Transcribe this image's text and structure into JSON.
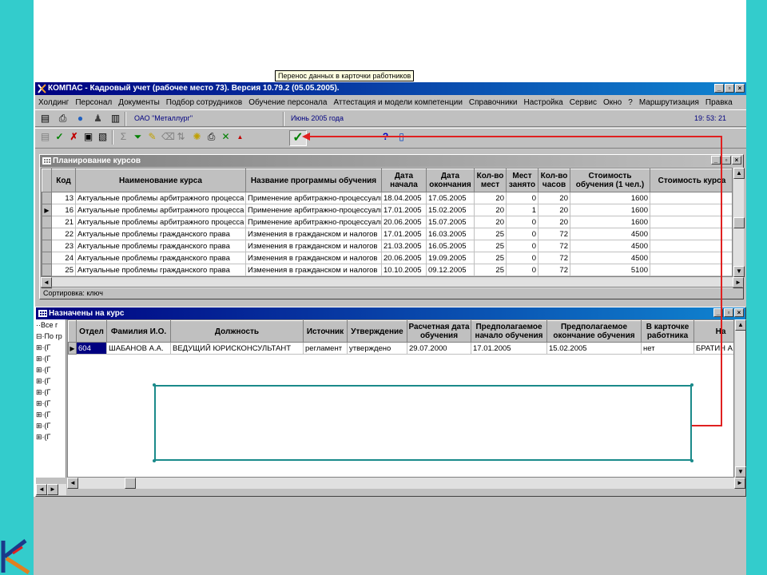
{
  "window": {
    "title": "КОМПАС - Кадровый учет (рабочее место 73). Версия 10.79.2 (05.05.2005).",
    "controls": [
      "_",
      "▫",
      "×"
    ]
  },
  "menu": [
    "Холдинг",
    "Персонал",
    "Документы",
    "Подбор сотрудников",
    "Обучение персонала",
    "Аттестация и модели компетенции",
    "Справочники",
    "Настройка",
    "Сервис",
    "Окно",
    "?",
    "Маршрутизация",
    "Правка"
  ],
  "toolbar": {
    "company": "ОАО \"Металлург\"",
    "period": "Июнь 2005 года",
    "clock": "19: 53: 21",
    "tooltip": "Перенос данных в карточки работников"
  },
  "courses": {
    "title": "Планирование курсов",
    "columns": [
      "Код",
      "Наименование курса",
      "Название программы обучения",
      "Дата начала",
      "Дата окончания",
      "Кол-во мест",
      "Мест занято",
      "Кол-во часов",
      "Стоимость обучения (1 чел.)",
      "Стоимость курса"
    ],
    "rows": [
      {
        "code": "13",
        "name": "Актуальные проблемы арбитражного процесса",
        "program": "Применение арбитражно-процессуальн",
        "start": "18.04.2005",
        "end": "17.05.2005",
        "seats": "20",
        "taken": "0",
        "hours": "20",
        "cost": "1600",
        "total": ""
      },
      {
        "code": "16",
        "name": "Актуальные проблемы арбитражного процесса",
        "program": "Применение арбитражно-процессуальн",
        "start": "17.01.2005",
        "end": "15.02.2005",
        "seats": "20",
        "taken": "1",
        "hours": "20",
        "cost": "1600",
        "total": ""
      },
      {
        "code": "21",
        "name": "Актуальные проблемы арбитражного процесса",
        "program": "Применение арбитражно-процессуальн",
        "start": "20.06.2005",
        "end": "15.07.2005",
        "seats": "20",
        "taken": "0",
        "hours": "20",
        "cost": "1600",
        "total": ""
      },
      {
        "code": "22",
        "name": "Актуальные проблемы гражданского права",
        "program": "Изменения в гражданском и налогов",
        "start": "17.01.2005",
        "end": "16.03.2005",
        "seats": "25",
        "taken": "0",
        "hours": "72",
        "cost": "4500",
        "total": ""
      },
      {
        "code": "23",
        "name": "Актуальные проблемы гражданского права",
        "program": "Изменения в гражданском и налогов",
        "start": "21.03.2005",
        "end": "16.05.2005",
        "seats": "25",
        "taken": "0",
        "hours": "72",
        "cost": "4500",
        "total": ""
      },
      {
        "code": "24",
        "name": "Актуальные проблемы гражданского права",
        "program": "Изменения в гражданском и налогов",
        "start": "20.06.2005",
        "end": "19.09.2005",
        "seats": "25",
        "taken": "0",
        "hours": "72",
        "cost": "4500",
        "total": ""
      },
      {
        "code": "25",
        "name": "Актуальные проблемы гражданского права",
        "program": "Изменения в гражданском и налогов",
        "start": "10.10.2005",
        "end": "09.12.2005",
        "seats": "25",
        "taken": "0",
        "hours": "72",
        "cost": "5100",
        "total": ""
      }
    ],
    "status": "Сортировка: ключ"
  },
  "assigned": {
    "title": "Назначены на курс",
    "tree": [
      "Все г",
      "По гр",
      "(Г",
      "(Г",
      "(Г",
      "(Г",
      "(Г",
      "(Г",
      "(Г",
      "(Г",
      "(Г"
    ],
    "columns": [
      "Отдел",
      "Фамилия И.О.",
      "Должность",
      "Источник",
      "Утверждение",
      "Расчетная дата обучения",
      "Предполагаемое начало обучения",
      "Предполагаемое окончание обучения",
      "В карточке работника",
      "На"
    ],
    "rows": [
      {
        "dept": "604",
        "fio": "ШАБАНОВ А.А.",
        "position": "ВЕДУЩИЙ ЮРИСКОНСУЛЬТАНТ",
        "source": "регламент",
        "approval": "утверждено",
        "calc_date": "29.07.2000",
        "start": "17.01.2005",
        "end": "15.02.2005",
        "in_card": "нет",
        "na": "БРАТИН А."
      }
    ]
  },
  "colors": {
    "slide_bg": "#33cccc",
    "title_active": "#000080",
    "callout": "#1a8a8a",
    "arrow": "#e02020"
  }
}
